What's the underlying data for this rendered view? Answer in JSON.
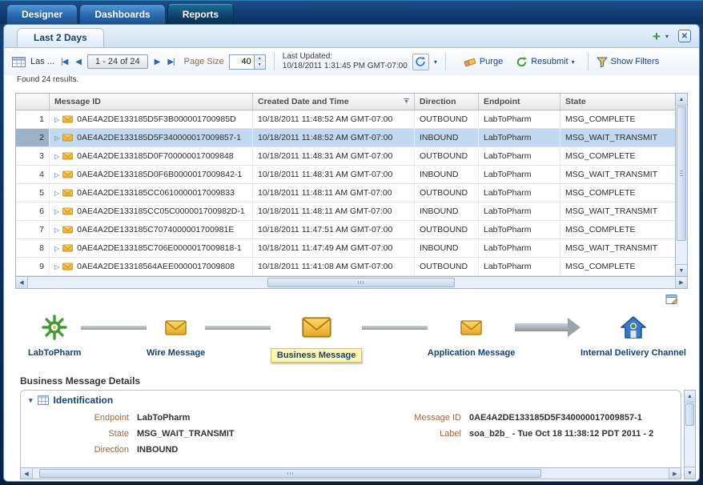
{
  "colors": {
    "accent_blue": "#2a66b8",
    "selected_row": "#c3d9f2",
    "envelope_gold": "#eeb02a",
    "flow_label_blue": "#16436e",
    "prompt_brown": "#9e6a41",
    "green_accent": "#3f9c35"
  },
  "app": {
    "tabs": [
      {
        "label": "Designer"
      },
      {
        "label": "Dashboards"
      },
      {
        "label": "Reports"
      }
    ]
  },
  "report": {
    "tab_label": "Last 2 Days",
    "toolbar": {
      "view_label": "Las ...",
      "page_range": "1 - 24 of 24",
      "page_size_label": "Page Size",
      "page_size_value": "40",
      "last_updated_label": "Last Updated:",
      "last_updated_value": "10/18/2011 1:31:45 PM GMT-07:00",
      "purge_label": "Purge",
      "resubmit_label": "Resubmit",
      "show_filters_label": "Show Filters"
    },
    "found_text": "Found 24 results.",
    "table": {
      "columns": {
        "message_id": "Message ID",
        "created": "Created Date and Time",
        "direction": "Direction",
        "endpoint": "Endpoint",
        "state": "State"
      },
      "rows": [
        {
          "num": "1",
          "message_id": "0AE4A2DE133185D5F3B000001700985D",
          "created": "10/18/2011 11:48:52 AM GMT-07:00",
          "direction": "OUTBOUND",
          "endpoint": "LabToPharm",
          "state": "MSG_COMPLETE"
        },
        {
          "num": "2",
          "message_id": "0AE4A2DE133185D5F340000017009857-1",
          "created": "10/18/2011 11:48:52 AM GMT-07:00",
          "direction": "INBOUND",
          "endpoint": "LabToPharm",
          "state": "MSG_WAIT_TRANSMIT"
        },
        {
          "num": "3",
          "message_id": "0AE4A2DE133185D0F700000017009848",
          "created": "10/18/2011 11:48:31 AM GMT-07:00",
          "direction": "OUTBOUND",
          "endpoint": "LabToPharm",
          "state": "MSG_COMPLETE"
        },
        {
          "num": "4",
          "message_id": "0AE4A2DE133185D0F6B0000017009842-1",
          "created": "10/18/2011 11:48:31 AM GMT-07:00",
          "direction": "INBOUND",
          "endpoint": "LabToPharm",
          "state": "MSG_WAIT_TRANSMIT"
        },
        {
          "num": "5",
          "message_id": "0AE4A2DE133185CC0610000017009833",
          "created": "10/18/2011 11:48:11 AM GMT-07:00",
          "direction": "OUTBOUND",
          "endpoint": "LabToPharm",
          "state": "MSG_COMPLETE"
        },
        {
          "num": "6",
          "message_id": "0AE4A2DE133185CC05C000001700982D-1",
          "created": "10/18/2011 11:48:11 AM GMT-07:00",
          "direction": "INBOUND",
          "endpoint": "LabToPharm",
          "state": "MSG_WAIT_TRANSMIT"
        },
        {
          "num": "7",
          "message_id": "0AE4A2DE133185C7074000001700981E",
          "created": "10/18/2011 11:47:51 AM GMT-07:00",
          "direction": "OUTBOUND",
          "endpoint": "LabToPharm",
          "state": "MSG_COMPLETE"
        },
        {
          "num": "8",
          "message_id": "0AE4A2DE133185C706E0000017009818-1",
          "created": "10/18/2011 11:47:49 AM GMT-07:00",
          "direction": "INBOUND",
          "endpoint": "LabToPharm",
          "state": "MSG_WAIT_TRANSMIT"
        },
        {
          "num": "9",
          "message_id": "0AE4A2DE13318564AEE0000017009808",
          "created": "10/18/2011 11:41:08 AM GMT-07:00",
          "direction": "OUTBOUND",
          "endpoint": "LabToPharm",
          "state": "MSG_COMPLETE"
        }
      ]
    }
  },
  "flow": {
    "nodes": [
      {
        "label": "LabToPharm"
      },
      {
        "label": "Wire Message"
      },
      {
        "label": "Business Message"
      },
      {
        "label": "Application Message"
      },
      {
        "label": "Internal Delivery Channel"
      }
    ]
  },
  "details": {
    "title": "Business Message Details",
    "section_title": "Identification",
    "endpoint_label": "Endpoint",
    "endpoint_value": "LabToPharm",
    "state_label": "State",
    "state_value": "MSG_WAIT_TRANSMIT",
    "direction_label": "Direction",
    "direction_value": "INBOUND",
    "message_id_label": "Message ID",
    "message_id_value": "0AE4A2DE133185D5F340000017009857-1",
    "label_label": "Label",
    "label_value": "soa_b2b_ - Tue Oct 18 11:38:12 PDT 2011 - 2"
  }
}
